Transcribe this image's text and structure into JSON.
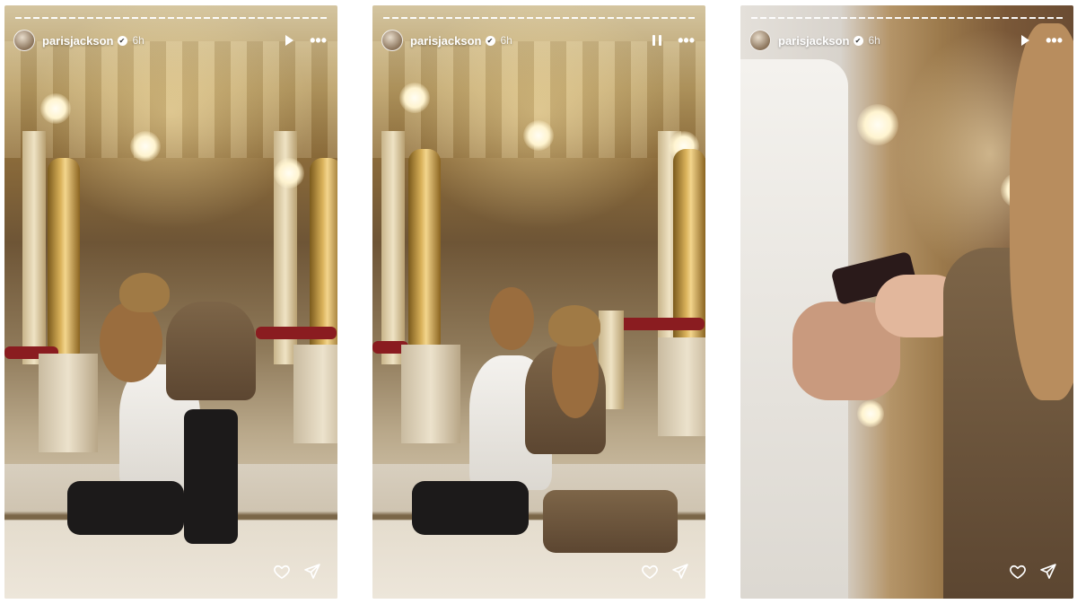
{
  "stories": [
    {
      "username": "parisjackson",
      "time": "6h",
      "playback": "play",
      "scene": "ballroom staircase proposal, kneeling couple embracing",
      "icons": {
        "verified": "verified-badge-icon",
        "playback": "play-icon",
        "more": "more-options-icon",
        "like": "heart-icon",
        "share": "send-icon"
      }
    },
    {
      "username": "parisjackson",
      "time": "6h",
      "playback": "pause",
      "scene": "ballroom staircase proposal, both kneeling in embrace",
      "icons": {
        "verified": "verified-badge-icon",
        "playback": "pause-icon",
        "more": "more-options-icon",
        "like": "heart-icon",
        "share": "send-icon"
      }
    },
    {
      "username": "parisjackson",
      "time": "6h",
      "playback": "play",
      "scene": "close-up of ring being placed on finger",
      "icons": {
        "verified": "verified-badge-icon",
        "playback": "play-icon",
        "more": "more-options-icon",
        "like": "heart-icon",
        "share": "send-icon"
      }
    }
  ],
  "colors": {
    "overlay_text": "#ffffff",
    "railing": "#8a1c20",
    "gold": "#d9b15a"
  }
}
